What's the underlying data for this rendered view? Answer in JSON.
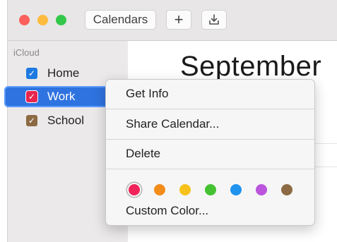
{
  "toolbar": {
    "calendars_label": "Calendars",
    "add_label": "+"
  },
  "sidebar": {
    "section_label": "iCloud",
    "items": [
      {
        "label": "Home",
        "color": "#1f7ae0",
        "checked": true,
        "selected": false
      },
      {
        "label": "Work",
        "color": "#e8254d",
        "checked": true,
        "selected": true
      },
      {
        "label": "School",
        "color": "#8c6a43",
        "checked": true,
        "selected": false
      }
    ]
  },
  "main": {
    "month_title": "September"
  },
  "context_menu": {
    "items": {
      "get_info": "Get Info",
      "share_calendar": "Share Calendar...",
      "delete": "Delete",
      "custom_color": "Custom Color..."
    },
    "colors": [
      {
        "name": "red",
        "hex": "#f0245a",
        "selected": true
      },
      {
        "name": "orange",
        "hex": "#f28c1a"
      },
      {
        "name": "yellow",
        "hex": "#f6c21a"
      },
      {
        "name": "green",
        "hex": "#44c232"
      },
      {
        "name": "blue",
        "hex": "#1f93ee"
      },
      {
        "name": "purple",
        "hex": "#bb55dd"
      },
      {
        "name": "brown",
        "hex": "#8c6a43"
      }
    ]
  },
  "icons": {
    "checkmark": "checkmark-icon",
    "import": "download-tray-icon"
  }
}
